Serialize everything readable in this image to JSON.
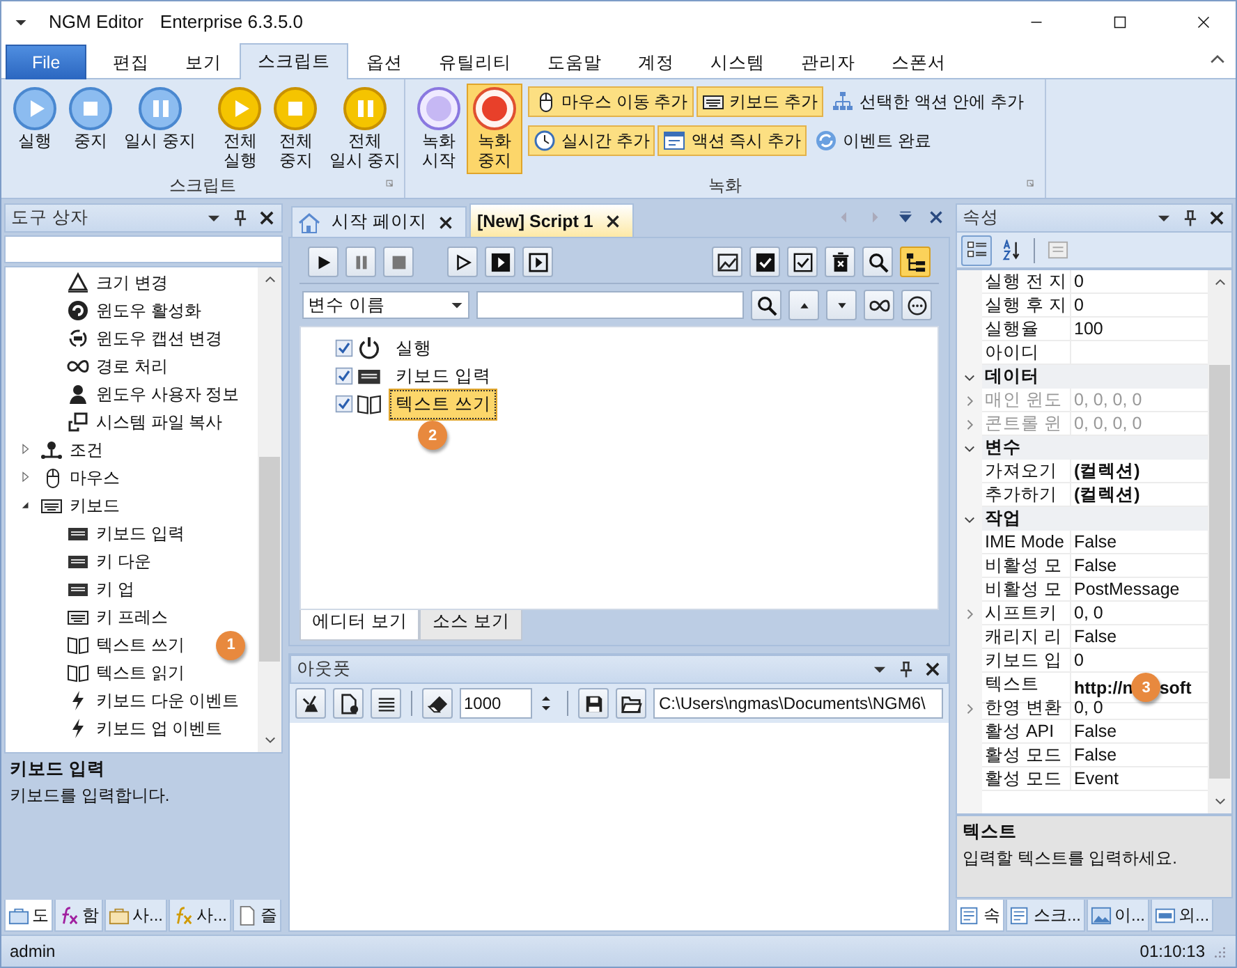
{
  "window": {
    "title": "NGM Editor",
    "edition": "Enterprise 6.3.5.0"
  },
  "ribbon_tabs": [
    {
      "label": "File",
      "kind": "file",
      "selected": false
    },
    {
      "label": "편집",
      "kind": "tab",
      "selected": false
    },
    {
      "label": "보기",
      "kind": "tab",
      "selected": false
    },
    {
      "label": "스크립트",
      "kind": "tab",
      "selected": true
    },
    {
      "label": "옵션",
      "kind": "tab",
      "selected": false
    },
    {
      "label": "유틸리티",
      "kind": "tab",
      "selected": false
    },
    {
      "label": "도움말",
      "kind": "tab",
      "selected": false
    },
    {
      "label": "계정",
      "kind": "tab",
      "selected": false
    },
    {
      "label": "시스템",
      "kind": "tab",
      "selected": false
    },
    {
      "label": "관리자",
      "kind": "tab",
      "selected": false
    },
    {
      "label": "스폰서",
      "kind": "tab",
      "selected": false
    }
  ],
  "ribbon_groups": [
    {
      "title": "스크립트",
      "sets": [
        [
          {
            "label": "실행",
            "active": false
          },
          {
            "label": "중지",
            "active": false
          },
          {
            "label": "일시 중지",
            "active": false
          }
        ],
        [
          {
            "label": "전체\n실행",
            "active": false
          },
          {
            "label": "전체\n중지",
            "active": false
          },
          {
            "label": "전체\n일시 중지",
            "active": false
          }
        ]
      ]
    },
    {
      "title": "녹화",
      "sets": [
        [
          {
            "label": "녹화\n시작",
            "active": false
          },
          {
            "label": "녹화\n중지",
            "active": true
          }
        ]
      ],
      "small_rows": [
        [
          {
            "label": "마우스 이동 추가",
            "active": true
          },
          {
            "label": "키보드 추가",
            "active": true
          },
          {
            "label": "선택한 액션 안에 추가",
            "active": false
          }
        ],
        [
          {
            "label": "실시간 추가",
            "active": true
          },
          {
            "label": "액션 즉시 추가",
            "active": true
          },
          {
            "label": "이벤트 완료",
            "active": false
          }
        ]
      ]
    }
  ],
  "toolbox": {
    "title": "도구 상자",
    "continued_items": [
      {
        "label": "크기 변경"
      },
      {
        "label": "윈도우 활성화"
      },
      {
        "label": "윈도우 캡션 변경"
      },
      {
        "label": "경로 처리"
      },
      {
        "label": "윈도우 사용자 정보"
      },
      {
        "label": "시스템 파일 복사"
      }
    ],
    "categories": [
      {
        "label": "조건",
        "expanded": false
      },
      {
        "label": "마우스",
        "expanded": false
      },
      {
        "label": "키보드",
        "expanded": true,
        "children": [
          {
            "label": "키보드 입력"
          },
          {
            "label": "키 다운"
          },
          {
            "label": "키 업"
          },
          {
            "label": "키 프레스"
          },
          {
            "label": "텍스트 쓰기",
            "badge": "1"
          },
          {
            "label": "텍스트 읽기"
          },
          {
            "label": "키보드 다운 이벤트"
          },
          {
            "label": "키보드 업 이벤트"
          }
        ]
      }
    ],
    "description": {
      "title": "키보드 입력",
      "text": "키보드를 입력합니다."
    },
    "tabs": [
      {
        "label": "도",
        "selected": true
      },
      {
        "label": "함",
        "selected": false
      },
      {
        "label": "사...",
        "selected": false
      },
      {
        "label": "사...",
        "selected": false
      },
      {
        "label": "즐",
        "selected": false
      }
    ]
  },
  "document_tabs": [
    {
      "label": "시작 페이지",
      "selected": false
    },
    {
      "label": "[New] Script 1",
      "selected": true
    }
  ],
  "script": {
    "variable_filter": "변수 이름",
    "tree": [
      {
        "label": "실행",
        "checked": true,
        "selected": false
      },
      {
        "label": "키보드 입력",
        "checked": true,
        "selected": false
      },
      {
        "label": "텍스트 쓰기",
        "checked": true,
        "selected": true,
        "badge": "2"
      }
    ],
    "view_tabs": [
      {
        "label": "에디터 보기",
        "selected": true
      },
      {
        "label": "소스 보기",
        "selected": false
      }
    ]
  },
  "output": {
    "title": "아웃풋",
    "limit": "1000",
    "path": "C:\\Users\\ngmas\\Documents\\NGM6\\"
  },
  "properties": {
    "title": "속성",
    "continued_rows": [
      {
        "name": "실행 전 지",
        "value": "0"
      },
      {
        "name": "실행 후 지",
        "value": "0"
      },
      {
        "name": "실행율",
        "value": "100"
      },
      {
        "name": "아이디"
      }
    ],
    "categories": [
      {
        "label": "데이터",
        "expanded": true,
        "rows": [
          {
            "name": "매인 윈도",
            "value": "0, 0, 0, 0",
            "expandable": true,
            "disabled": true
          },
          {
            "name": "콘트롤 윈",
            "value": "0, 0, 0, 0",
            "expandable": true,
            "disabled": true
          }
        ]
      },
      {
        "label": "변수",
        "expanded": true,
        "rows": [
          {
            "name": "가져오기",
            "value": "(컬렉션)",
            "bold": true
          },
          {
            "name": "추가하기",
            "value": "(컬렉션)",
            "bold": true
          }
        ]
      },
      {
        "label": "작업",
        "expanded": true,
        "rows": [
          {
            "name": "IME Mode",
            "value": "False"
          },
          {
            "name": "비활성 모",
            "value": "False"
          },
          {
            "name": "비활성 모",
            "value": "PostMessage"
          },
          {
            "name": "시프트키",
            "value": "0, 0",
            "expandable": true
          },
          {
            "name": "캐리지 리",
            "value": "False"
          },
          {
            "name": "키보드 입",
            "value": "0"
          },
          {
            "name": "텍스트",
            "value": "http://n",
            "bold": true,
            "badge": "3",
            "value_after_badge": "soft"
          },
          {
            "name": "한영 변환",
            "value": "0, 0",
            "expandable": true
          },
          {
            "name": "활성 API",
            "value": "False"
          },
          {
            "name": "활성 모드",
            "value": "False"
          },
          {
            "name": "활성 모드",
            "value": "Event"
          }
        ]
      }
    ],
    "description": {
      "title": "텍스트",
      "text": "입력할 텍스트를 입력하세요."
    },
    "tabs": [
      {
        "label": "속",
        "selected": true
      },
      {
        "label": "스크...",
        "selected": false
      },
      {
        "label": "이...",
        "selected": false
      },
      {
        "label": "외...",
        "selected": false
      }
    ]
  },
  "status_bar": {
    "user": "admin",
    "time": "01:10:13"
  }
}
